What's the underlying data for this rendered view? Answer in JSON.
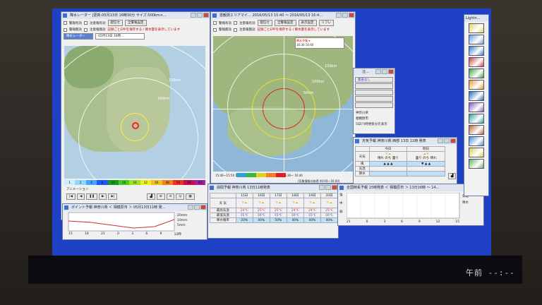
{
  "clock": {
    "label": "午前 --:--"
  },
  "radar_window": {
    "title": "降水レーダー [更新:05月13日 16時30分 サイズ:500km×...",
    "checks": [
      "警報有効",
      "注意報有効",
      "警報無効",
      "注意報無効"
    ],
    "buttons": [
      "配信セ",
      "全警報設定"
    ],
    "notice": "記録ごとEPPを保存する / 降水量を表示しています",
    "time_label": "05月13日 16時...",
    "ring_labels": [
      "150km",
      "100km"
    ],
    "scale_values": [
      "1",
      "2",
      "4",
      "8",
      "12",
      "16",
      "24",
      "32",
      "40",
      "48",
      "56",
      "64",
      "80"
    ],
    "scale_colors": [
      "#c8f0ff",
      "#8fd8ff",
      "#3fa8ff",
      "#1a5bff",
      "#1a9a1a",
      "#44cc22",
      "#a0e020",
      "#f0f020",
      "#f0c020",
      "#f08020",
      "#f03020",
      "#c01050",
      "#a020a0"
    ],
    "controls_label": "アニメーション"
  },
  "lightning_window": {
    "title": "雷観測エリアマイ… 2016/05/13 15:40 ～ 2016/05/13 16:4...",
    "checks": [
      "警報有効",
      "注意報有効",
      "警報無効",
      "注意報無効"
    ],
    "buttons": [
      "配信セ",
      "全警報設定",
      "表示設定",
      "リフレ"
    ],
    "notice": "記録ごとEPPを保存する / 降水量を表示しています",
    "time_label": "15:40～15:50 15:50～ 16:00～ 16:10～ 16:20～ 16:30～ 16:40",
    "legend_colors": [
      "#2fa0e0",
      "#3bb43b",
      "#e0d020",
      "#f08020",
      "#e02020"
    ],
    "ring_labels": [
      "150km",
      "100km",
      "50km"
    ],
    "footer": "(気象情報の取得 00:00～16:00)"
  },
  "alert_panel": {
    "title": "注…",
    "items": [
      "発表なし",
      "",
      "",
      "",
      ""
    ],
    "labels": [
      "神奈川県",
      "相模原市"
    ],
    "footer": "5日(?)時更新分を表示"
  },
  "weather_window": {
    "title": "天気予報 神奈川県 西部 13日 11時 発表",
    "days": [
      "今日",
      "明日"
    ],
    "weather": [
      "晴れ のち 曇り",
      "曇り のち 晴れ"
    ],
    "rows": [
      "天気",
      "風",
      "気温",
      "降水"
    ]
  },
  "weekly_window": {
    "title": "週間予報 神奈川県 13日11時発表",
    "dates": [
      "15日",
      "16日",
      "17日",
      "18日",
      "19日",
      "20日"
    ],
    "row_labels": [
      "天 気",
      "最高気温",
      "最低気温",
      "降水確率"
    ],
    "high": [
      "24℃",
      "25℃",
      "25℃",
      "24℃",
      "24℃",
      "25℃"
    ],
    "low": [
      "15℃",
      "16℃",
      "15℃",
      "16℃",
      "15℃",
      "16℃"
    ],
    "pop": [
      "20%",
      "40%",
      "50%",
      "40%",
      "40%",
      "40%"
    ]
  },
  "point_window": {
    "title": "ポイント予報 神奈川県 ＜ 相模原市 ＞ 05月13日11時 発...",
    "times": [
      "15",
      "18",
      "21",
      "0",
      "3",
      "6",
      "9",
      "12時"
    ],
    "legend": [
      "20mm",
      "10mm",
      "5mm"
    ]
  },
  "hourly_window": {
    "title": "全国時系予報 15時発表 ＜ 相模原市 ＞ 13日16時 ～ 14...",
    "side_labels": [
      "強",
      "中",
      "弱"
    ],
    "times": [
      "21",
      "0",
      "3",
      "6",
      "9",
      "12",
      "15"
    ],
    "legend": [
      "気温",
      "降水"
    ]
  },
  "side_panel": {
    "title": "Lightn…",
    "thumb_colors": [
      "#e8d060",
      "#6aa0e0",
      "#3a7ad0",
      "#d04040",
      "#40a040",
      "#e0a030",
      "#2a6ab0",
      "#8a5ac0",
      "#30a0a0",
      "#c06030",
      "#4a8ad0",
      "#d0d050",
      "#60b060"
    ]
  }
}
